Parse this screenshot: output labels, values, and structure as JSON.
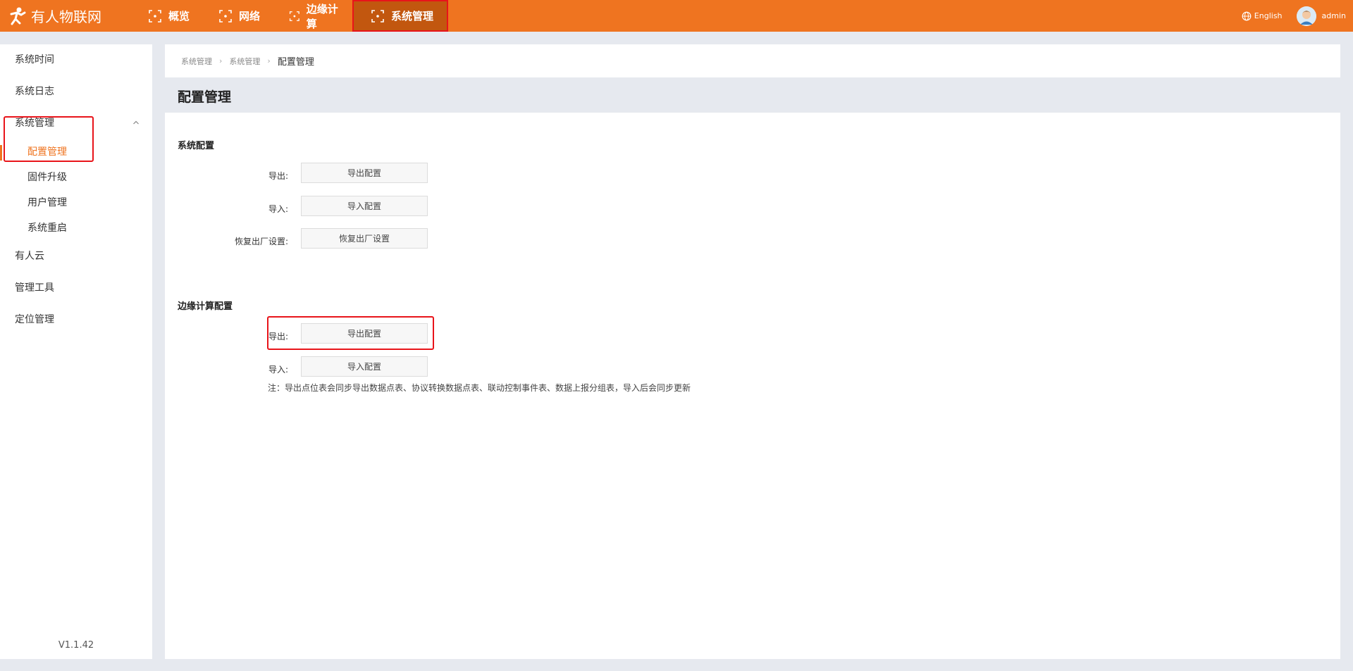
{
  "brand": {
    "name": "有人物联网"
  },
  "nav": [
    {
      "label": "概览"
    },
    {
      "label": "网络"
    },
    {
      "label": "边缘计算"
    },
    {
      "label": "系统管理"
    }
  ],
  "topright": {
    "language": "English",
    "user": "admin"
  },
  "sidebar": {
    "items": [
      {
        "label": "系统时间"
      },
      {
        "label": "系统日志"
      },
      {
        "label": "系统管理"
      },
      {
        "label": "有人云"
      },
      {
        "label": "管理工具"
      },
      {
        "label": "定位管理"
      }
    ],
    "subitems": [
      {
        "label": "配置管理"
      },
      {
        "label": "固件升级"
      },
      {
        "label": "用户管理"
      },
      {
        "label": "系统重启"
      }
    ],
    "version": "V1.1.42"
  },
  "breadcrumb": [
    "系统管理",
    "系统管理",
    "配置管理"
  ],
  "page": {
    "title": "配置管理"
  },
  "system_config": {
    "title": "系统配置",
    "rows": [
      {
        "label": "导出:",
        "button": "导出配置"
      },
      {
        "label": "导入:",
        "button": "导入配置"
      },
      {
        "label": "恢复出厂设置:",
        "button": "恢复出厂设置"
      }
    ]
  },
  "edge_config": {
    "title": "边缘计算配置",
    "rows": [
      {
        "label": "导出:",
        "button": "导出配置"
      },
      {
        "label": "导入:",
        "button": "导入配置"
      }
    ],
    "note": "注：导出点位表会同步导出数据点表、协议转换数据点表、联动控制事件表、数据上报分组表，导入后会同步更新"
  },
  "colors": {
    "accent": "#ef7420",
    "highlight": "#e8141a"
  }
}
